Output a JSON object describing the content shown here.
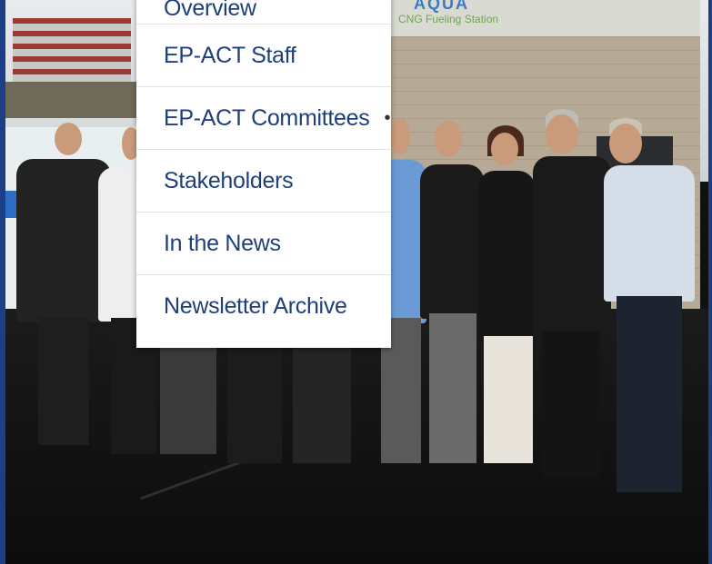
{
  "background": {
    "sign_logo": "AQUA",
    "sign_text": "CNG Fueling Station"
  },
  "menu": {
    "items": [
      {
        "label": "Overview",
        "has_submenu": false
      },
      {
        "label": "EP-ACT Staff",
        "has_submenu": false
      },
      {
        "label": "EP-ACT Committees",
        "has_submenu": true,
        "indicator": "•"
      },
      {
        "label": "Stakeholders",
        "has_submenu": false
      },
      {
        "label": "In the News",
        "has_submenu": false
      },
      {
        "label": "Newsletter Archive",
        "has_submenu": false
      }
    ]
  },
  "colors": {
    "menu_text": "#1f3f7a",
    "menu_bg": "#ffffff",
    "brand_blue": "#1d3f86"
  }
}
